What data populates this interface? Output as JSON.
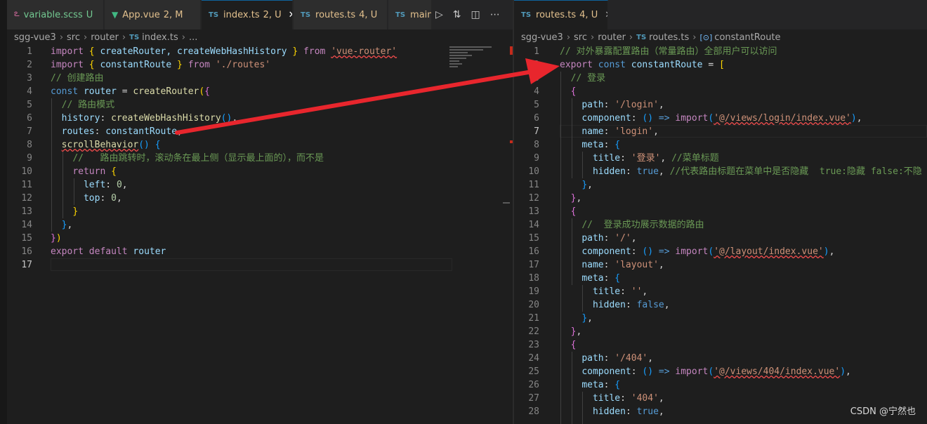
{
  "colors": {
    "background": "#1e1e1e",
    "tab_bar": "#252526",
    "arrow": "#e8262d"
  },
  "left_editor": {
    "tabs": [
      {
        "label": "variable.scss",
        "status": "U",
        "icon": "sass-icon",
        "status_color": "#73c991"
      },
      {
        "label": "App.vue",
        "status": "2, M",
        "icon": "vue-icon",
        "status_color": "#e2c08d"
      },
      {
        "label": "index.ts",
        "status": "2, U",
        "icon": "ts-icon",
        "status_color": "#e2c08d",
        "active": true
      },
      {
        "label": "routes.ts",
        "status": "4, U",
        "icon": "ts-icon",
        "status_color": "#e2c08d"
      },
      {
        "label": "main.",
        "status": "",
        "icon": "ts-icon",
        "status_color": ""
      }
    ],
    "ts_badge": "TS",
    "close_glyph": "✕",
    "breadcrumb": [
      "sgg-vue3",
      "src",
      "router",
      "index.ts",
      "..."
    ],
    "lines": [
      {
        "n": "1",
        "tokens": [
          [
            "import",
            "kc"
          ],
          [
            " ",
            ""
          ],
          [
            "{",
            "b1"
          ],
          [
            " createRouter, createWebHashHistory ",
            "v"
          ],
          [
            "}",
            "b1"
          ],
          [
            " ",
            ""
          ],
          [
            "from",
            "kc"
          ],
          [
            " ",
            ""
          ],
          [
            "'vue-router'",
            "s sq"
          ]
        ]
      },
      {
        "n": "2",
        "tokens": [
          [
            "import",
            "kc"
          ],
          [
            " ",
            ""
          ],
          [
            "{",
            "b1"
          ],
          [
            " constantRoute ",
            "v"
          ],
          [
            "}",
            "b1"
          ],
          [
            " ",
            ""
          ],
          [
            "from",
            "kc"
          ],
          [
            " ",
            ""
          ],
          [
            "'./routes'",
            "s"
          ]
        ]
      },
      {
        "n": "3",
        "tokens": [
          [
            "// 创建路由",
            "c"
          ]
        ]
      },
      {
        "n": "4",
        "tokens": [
          [
            "const",
            "k"
          ],
          [
            " ",
            ""
          ],
          [
            "router",
            "v"
          ],
          [
            " = ",
            "p"
          ],
          [
            "createRouter",
            "f"
          ],
          [
            "(",
            "b1"
          ],
          [
            "{",
            "b2"
          ]
        ]
      },
      {
        "n": "5",
        "tokens": [
          [
            "  ",
            ""
          ],
          [
            "// 路由模式",
            "c"
          ]
        ]
      },
      {
        "n": "6",
        "tokens": [
          [
            "  ",
            ""
          ],
          [
            "history",
            "v"
          ],
          [
            ": ",
            "p"
          ],
          [
            "createWebHashHistory",
            "f"
          ],
          [
            "()",
            "b3"
          ],
          [
            ",",
            "p"
          ]
        ]
      },
      {
        "n": "7",
        "tokens": [
          [
            "  ",
            ""
          ],
          [
            "routes",
            "v"
          ],
          [
            ": ",
            "p"
          ],
          [
            "constantRoute",
            "v"
          ],
          [
            ",",
            "p"
          ]
        ]
      },
      {
        "n": "8",
        "tokens": [
          [
            "  ",
            ""
          ],
          [
            "scrollBehavior",
            "f sq"
          ],
          [
            "() ",
            "b3"
          ],
          [
            "{",
            "b3"
          ]
        ]
      },
      {
        "n": "9",
        "tokens": [
          [
            "    ",
            ""
          ],
          [
            "//   路由跳转时，滚动条在最上侧（显示最上面的），而不是",
            "c"
          ]
        ]
      },
      {
        "n": "10",
        "tokens": [
          [
            "    ",
            ""
          ],
          [
            "return",
            "kc"
          ],
          [
            " ",
            ""
          ],
          [
            "{",
            "b1"
          ]
        ]
      },
      {
        "n": "11",
        "tokens": [
          [
            "      ",
            ""
          ],
          [
            "left",
            "v"
          ],
          [
            ": ",
            "p"
          ],
          [
            "0",
            "n"
          ],
          [
            ",",
            "p"
          ]
        ]
      },
      {
        "n": "12",
        "tokens": [
          [
            "      ",
            ""
          ],
          [
            "top",
            "v"
          ],
          [
            ": ",
            "p"
          ],
          [
            "0",
            "n"
          ],
          [
            ",",
            "p"
          ]
        ]
      },
      {
        "n": "13",
        "tokens": [
          [
            "    ",
            ""
          ],
          [
            "}",
            "b1"
          ]
        ]
      },
      {
        "n": "14",
        "tokens": [
          [
            "  ",
            ""
          ],
          [
            "}",
            "b3"
          ],
          [
            ",",
            "p"
          ]
        ]
      },
      {
        "n": "15",
        "tokens": [
          [
            "}",
            "b2"
          ],
          [
            ")",
            "b1"
          ]
        ]
      },
      {
        "n": "16",
        "tokens": [
          [
            "export",
            "kc"
          ],
          [
            " ",
            ""
          ],
          [
            "default",
            "kc"
          ],
          [
            " ",
            ""
          ],
          [
            "router",
            "v"
          ]
        ]
      },
      {
        "n": "17",
        "tokens": [],
        "current": true
      }
    ]
  },
  "right_editor": {
    "tab": {
      "label": "routes.ts",
      "status": "4, U",
      "icon": "ts-icon"
    },
    "ts_badge": "TS",
    "close_glyph": "✕",
    "breadcrumb": [
      "sgg-vue3",
      "src",
      "router",
      "routes.ts",
      "constantRoute"
    ],
    "lines": [
      {
        "n": "1",
        "tokens": [
          [
            "// 对外暴露配置路由（常量路由）全部用户可以访问",
            "c"
          ]
        ]
      },
      {
        "n": "2",
        "tokens": [
          [
            "export",
            "kc"
          ],
          [
            " ",
            ""
          ],
          [
            "const",
            "k"
          ],
          [
            " ",
            ""
          ],
          [
            "constantRoute",
            "v"
          ],
          [
            " = ",
            "p"
          ],
          [
            "[",
            "b1"
          ]
        ]
      },
      {
        "n": "3",
        "tokens": [
          [
            "  ",
            ""
          ],
          [
            "// 登录",
            "c"
          ]
        ]
      },
      {
        "n": "4",
        "tokens": [
          [
            "  ",
            ""
          ],
          [
            "{",
            "b2"
          ]
        ]
      },
      {
        "n": "5",
        "tokens": [
          [
            "    ",
            ""
          ],
          [
            "path",
            "v"
          ],
          [
            ": ",
            "p"
          ],
          [
            "'/login'",
            "s"
          ],
          [
            ",",
            "p"
          ]
        ]
      },
      {
        "n": "6",
        "tokens": [
          [
            "    ",
            ""
          ],
          [
            "component",
            "v"
          ],
          [
            ": ",
            "p"
          ],
          [
            "()",
            "b3"
          ],
          [
            " => ",
            "k"
          ],
          [
            "import",
            "kc"
          ],
          [
            "(",
            "b3"
          ],
          [
            "'@/views/login/index.vue'",
            "s sq"
          ],
          [
            ")",
            "b3"
          ],
          [
            ",",
            "p"
          ]
        ]
      },
      {
        "n": "7",
        "tokens": [
          [
            "    ",
            ""
          ],
          [
            "name",
            "v"
          ],
          [
            ": ",
            "p"
          ],
          [
            "'login'",
            "s"
          ],
          [
            ",",
            "p"
          ]
        ],
        "current": true
      },
      {
        "n": "8",
        "tokens": [
          [
            "    ",
            ""
          ],
          [
            "meta",
            "v"
          ],
          [
            ": ",
            "p"
          ],
          [
            "{",
            "b3"
          ]
        ]
      },
      {
        "n": "9",
        "tokens": [
          [
            "      ",
            ""
          ],
          [
            "title",
            "v"
          ],
          [
            ": ",
            "p"
          ],
          [
            "'登录'",
            "s"
          ],
          [
            ", ",
            "p"
          ],
          [
            "//菜单标题",
            "c"
          ]
        ]
      },
      {
        "n": "10",
        "tokens": [
          [
            "      ",
            ""
          ],
          [
            "hidden",
            "v"
          ],
          [
            ": ",
            "p"
          ],
          [
            "true",
            "k"
          ],
          [
            ", ",
            "p"
          ],
          [
            "//代表路由标题在菜单中是否隐藏  true:隐藏 false:不隐",
            "c"
          ]
        ]
      },
      {
        "n": "11",
        "tokens": [
          [
            "    ",
            ""
          ],
          [
            "}",
            "b3"
          ],
          [
            ",",
            "p"
          ]
        ]
      },
      {
        "n": "12",
        "tokens": [
          [
            "  ",
            ""
          ],
          [
            "}",
            "b2"
          ],
          [
            ",",
            "p"
          ]
        ]
      },
      {
        "n": "13",
        "tokens": [
          [
            "  ",
            ""
          ],
          [
            "{",
            "b2"
          ]
        ]
      },
      {
        "n": "14",
        "tokens": [
          [
            "    ",
            ""
          ],
          [
            "//  登录成功展示数据的路由",
            "c"
          ]
        ]
      },
      {
        "n": "15",
        "tokens": [
          [
            "    ",
            ""
          ],
          [
            "path",
            "v"
          ],
          [
            ": ",
            "p"
          ],
          [
            "'/'",
            "s"
          ],
          [
            ",",
            "p"
          ]
        ]
      },
      {
        "n": "16",
        "tokens": [
          [
            "    ",
            ""
          ],
          [
            "component",
            "v"
          ],
          [
            ": ",
            "p"
          ],
          [
            "()",
            "b3"
          ],
          [
            " => ",
            "k"
          ],
          [
            "import",
            "kc"
          ],
          [
            "(",
            "b3"
          ],
          [
            "'@/layout/index.vue'",
            "s sq"
          ],
          [
            ")",
            "b3"
          ],
          [
            ",",
            "p"
          ]
        ]
      },
      {
        "n": "17",
        "tokens": [
          [
            "    ",
            ""
          ],
          [
            "name",
            "v"
          ],
          [
            ": ",
            "p"
          ],
          [
            "'layout'",
            "s"
          ],
          [
            ",",
            "p"
          ]
        ]
      },
      {
        "n": "18",
        "tokens": [
          [
            "    ",
            ""
          ],
          [
            "meta",
            "v"
          ],
          [
            ": ",
            "p"
          ],
          [
            "{",
            "b3"
          ]
        ]
      },
      {
        "n": "19",
        "tokens": [
          [
            "      ",
            ""
          ],
          [
            "title",
            "v"
          ],
          [
            ": ",
            "p"
          ],
          [
            "''",
            "s"
          ],
          [
            ",",
            "p"
          ]
        ]
      },
      {
        "n": "20",
        "tokens": [
          [
            "      ",
            ""
          ],
          [
            "hidden",
            "v"
          ],
          [
            ": ",
            "p"
          ],
          [
            "false",
            "k"
          ],
          [
            ",",
            "p"
          ]
        ]
      },
      {
        "n": "21",
        "tokens": [
          [
            "    ",
            ""
          ],
          [
            "}",
            "b3"
          ],
          [
            ",",
            "p"
          ]
        ]
      },
      {
        "n": "22",
        "tokens": [
          [
            "  ",
            ""
          ],
          [
            "}",
            "b2"
          ],
          [
            ",",
            "p"
          ]
        ]
      },
      {
        "n": "23",
        "tokens": [
          [
            "  ",
            ""
          ],
          [
            "{",
            "b2"
          ]
        ]
      },
      {
        "n": "24",
        "tokens": [
          [
            "    ",
            ""
          ],
          [
            "path",
            "v"
          ],
          [
            ": ",
            "p"
          ],
          [
            "'/404'",
            "s"
          ],
          [
            ",",
            "p"
          ]
        ]
      },
      {
        "n": "25",
        "tokens": [
          [
            "    ",
            ""
          ],
          [
            "component",
            "v"
          ],
          [
            ": ",
            "p"
          ],
          [
            "()",
            "b3"
          ],
          [
            " => ",
            "k"
          ],
          [
            "import",
            "kc"
          ],
          [
            "(",
            "b3"
          ],
          [
            "'@/views/404/index.vue'",
            "s sq"
          ],
          [
            ")",
            "b3"
          ],
          [
            ",",
            "p"
          ]
        ]
      },
      {
        "n": "26",
        "tokens": [
          [
            "    ",
            ""
          ],
          [
            "meta",
            "v"
          ],
          [
            ": ",
            "p"
          ],
          [
            "{",
            "b3"
          ]
        ]
      },
      {
        "n": "27",
        "tokens": [
          [
            "      ",
            ""
          ],
          [
            "title",
            "v"
          ],
          [
            ": ",
            "p"
          ],
          [
            "'404'",
            "s"
          ],
          [
            ",",
            "p"
          ]
        ]
      },
      {
        "n": "28",
        "tokens": [
          [
            "      ",
            ""
          ],
          [
            "hidden",
            "v"
          ],
          [
            ": ",
            "p"
          ],
          [
            "true",
            "k"
          ],
          [
            ",",
            "p"
          ]
        ]
      }
    ]
  },
  "icons": [
    "play-icon",
    "compare-changes-icon",
    "split-editor-icon",
    "more-actions-icon",
    "close-icon",
    "arrow-annotation"
  ],
  "watermark": "CSDN @宁然也"
}
